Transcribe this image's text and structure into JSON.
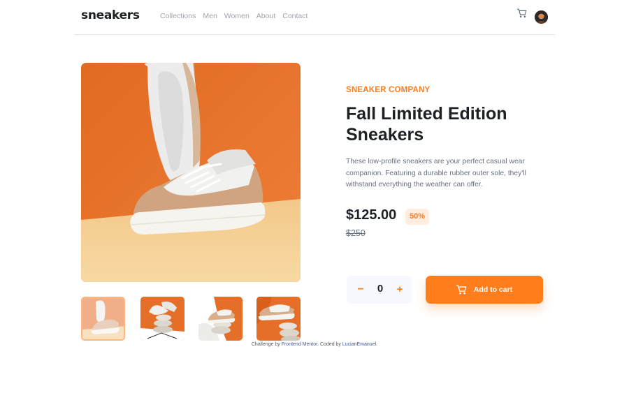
{
  "header": {
    "logo": "sneakers",
    "nav": [
      "Collections",
      "Men",
      "Women",
      "About",
      "Contact"
    ],
    "cart_icon": "cart-icon",
    "avatar_icon": "avatar"
  },
  "product": {
    "company": "SNEAKER COMPANY",
    "title": "Fall Limited Edition Sneakers",
    "description": "These low-profile sneakers are your perfect casual wear companion. Featuring a durable rubber outer sole, they'll withstand everything the weather can offer.",
    "price": "$125.00",
    "discount": "50%",
    "original_price": "$250"
  },
  "cart_controls": {
    "minus": "−",
    "quantity": "0",
    "plus": "+",
    "add_label": "Add to cart"
  },
  "attribution": {
    "prefix": "Challenge by",
    "challenge_link": "Frontend Mentor",
    "middle": ". Coded by",
    "author_link": "LucianEmanuel",
    "suffix": "."
  },
  "colors": {
    "accent": "#ff7d1a",
    "accent_pale": "#ffede0",
    "dark": "#1d2025",
    "muted": "#68707d"
  }
}
